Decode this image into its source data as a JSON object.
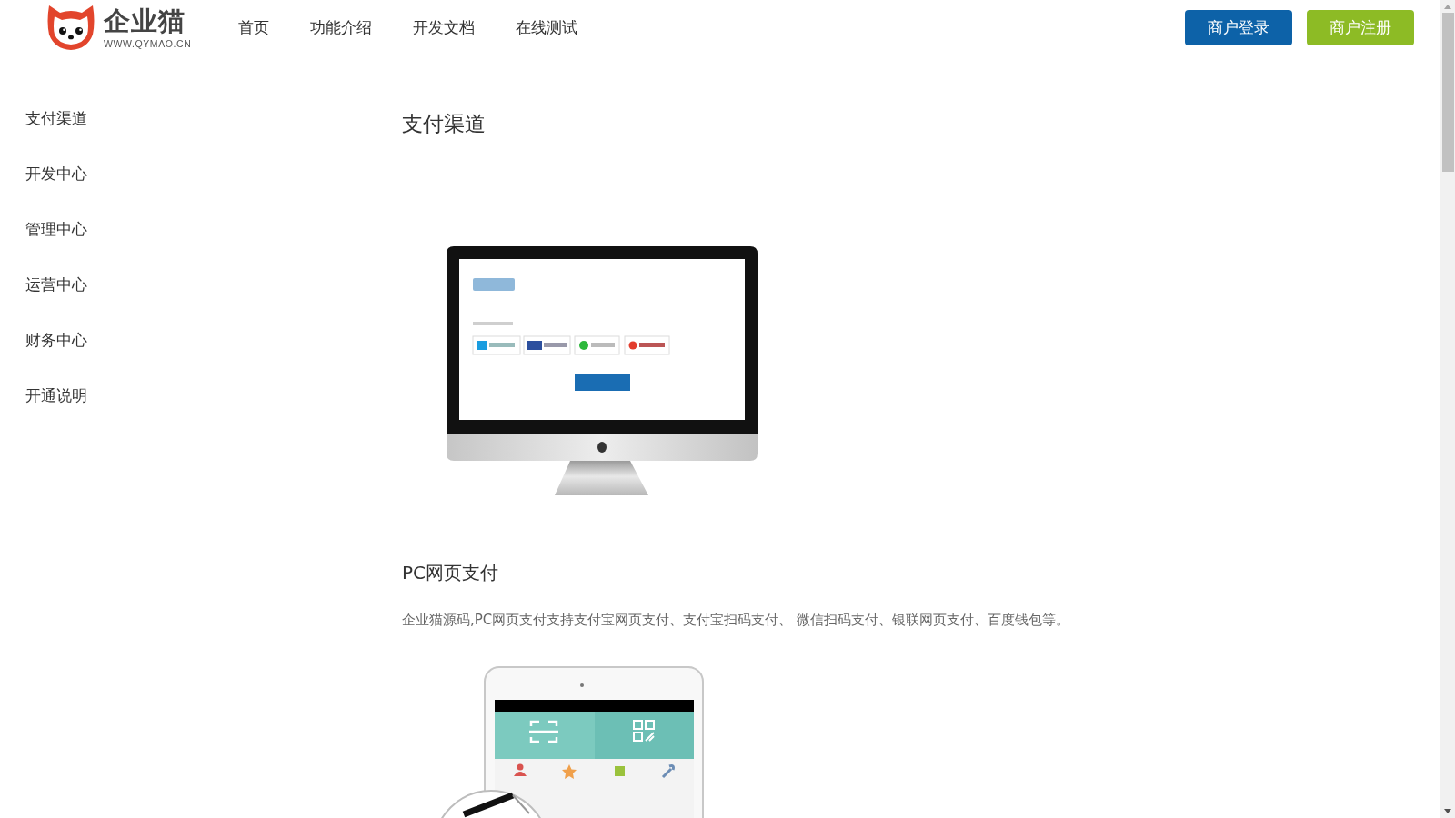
{
  "header": {
    "logo": {
      "name": "企业猫",
      "domain": "WWW.QYMAO.CN"
    },
    "nav": [
      {
        "label": "首页"
      },
      {
        "label": "功能介绍"
      },
      {
        "label": "开发文档"
      },
      {
        "label": "在线测试"
      }
    ],
    "buttons": [
      {
        "kind": "login",
        "label": "商户登录"
      },
      {
        "kind": "register",
        "label": "商户注册"
      }
    ]
  },
  "sidebar": {
    "items": [
      {
        "label": "支付渠道"
      },
      {
        "label": "开发中心"
      },
      {
        "label": "管理中心"
      },
      {
        "label": "运营中心"
      },
      {
        "label": "财务中心"
      },
      {
        "label": "开通说明"
      }
    ]
  },
  "content": {
    "title": "支付渠道",
    "blocks": [
      {
        "kind": "monitor"
      },
      {
        "kind": "heading",
        "text": "PC网页支付"
      },
      {
        "kind": "paragraph",
        "text": "企业猫源码,PC网页支付支持支付宝网页支付、支付宝扫码支付、 微信扫码支付、银联网页支付、百度钱包等。"
      },
      {
        "kind": "tablet"
      }
    ]
  }
}
